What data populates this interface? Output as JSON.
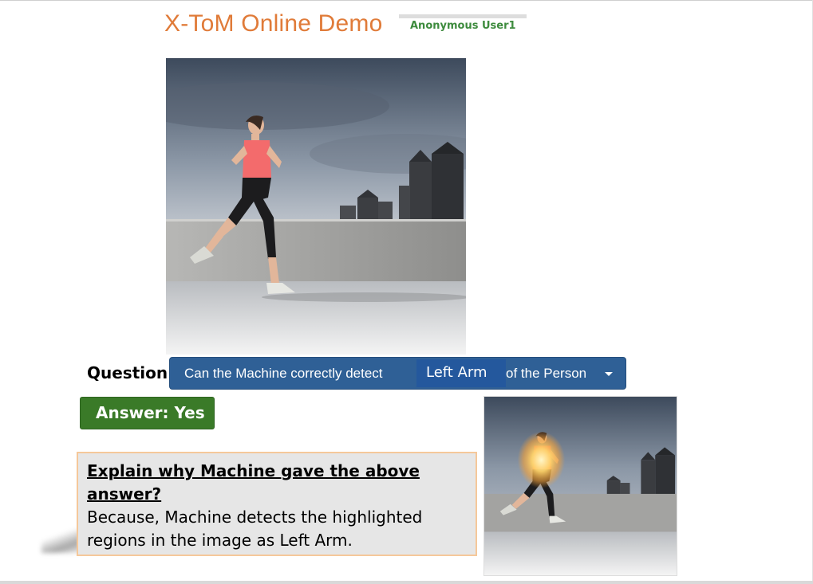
{
  "header": {
    "title": "X-ToM Online Demo",
    "user": "Anonymous User1"
  },
  "question": {
    "label": "Question",
    "colon": ":",
    "prefix": "Can the Machine correctly detect",
    "part": "Left Arm",
    "suffix": "of the Person"
  },
  "answer": {
    "label": "Answer: Yes"
  },
  "explanation": {
    "heading": "Explain why Machine gave the above answer?",
    "body_line1": "Because, Machine detects the highlighted",
    "body_line2": "regions in the image as Left Arm."
  },
  "colors": {
    "title": "#e07b39",
    "user": "#3d8b3d",
    "dropdown": "#2f6096",
    "answer": "#3a7a28"
  }
}
